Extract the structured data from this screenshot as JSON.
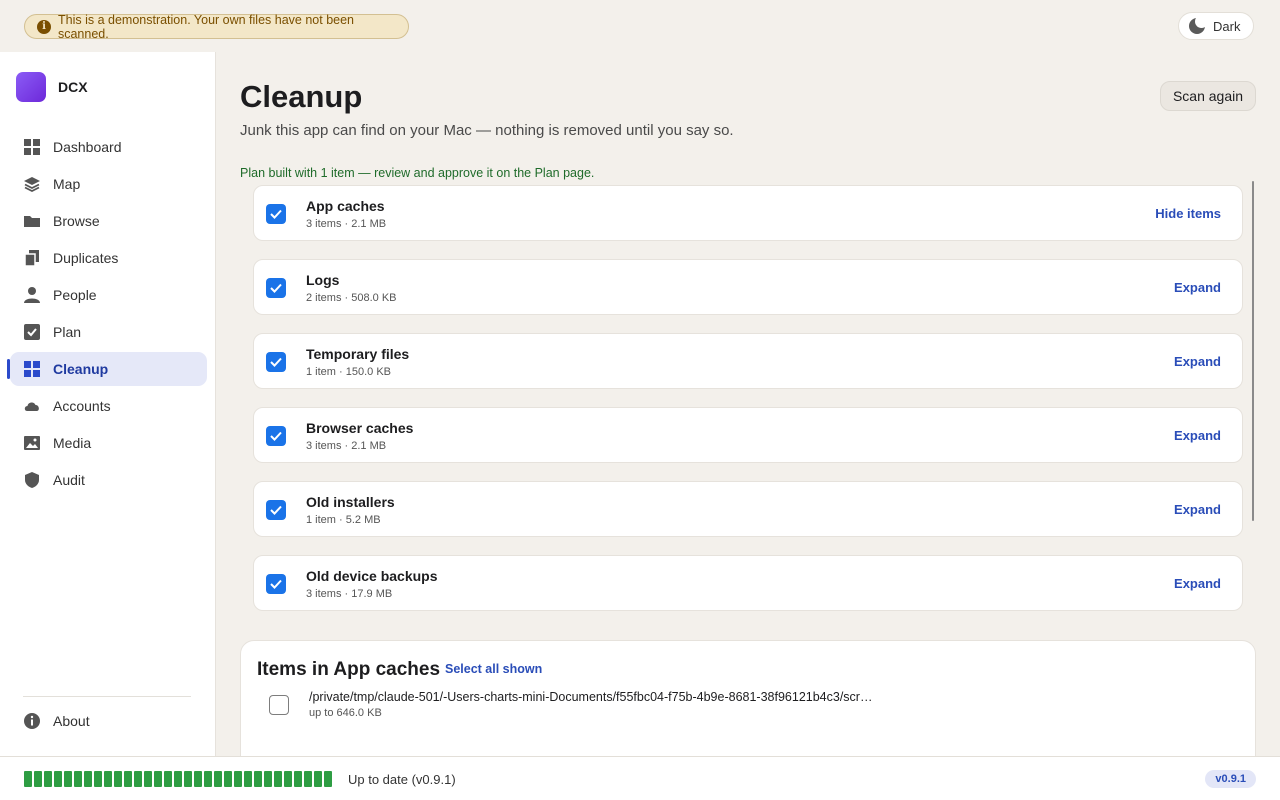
{
  "banner": {
    "text": "This is a demonstration. Your own files have not been scanned.",
    "icon": "info-icon"
  },
  "theme_toggle": {
    "label": "Dark",
    "icon": "moon-icon"
  },
  "brand": {
    "name": "DCX"
  },
  "sidebar": {
    "items": [
      {
        "label": "Dashboard",
        "icon": "grid-icon"
      },
      {
        "label": "Map",
        "icon": "layers-icon"
      },
      {
        "label": "Browse",
        "icon": "folder-icon"
      },
      {
        "label": "Duplicates",
        "icon": "copy-icon"
      },
      {
        "label": "People",
        "icon": "person-icon"
      },
      {
        "label": "Plan",
        "icon": "checkbox-icon"
      },
      {
        "label": "Cleanup",
        "icon": "grid-icon",
        "active": true
      },
      {
        "label": "Accounts",
        "icon": "cloud-icon"
      },
      {
        "label": "Media",
        "icon": "image-icon"
      },
      {
        "label": "Audit",
        "icon": "shield-icon"
      }
    ],
    "about": "About"
  },
  "main": {
    "title": "Cleanup",
    "subtitle": "Junk this app can find on your Mac — nothing is removed until you say so.",
    "scan_again": "Scan again",
    "plan_message": "Plan built with 1 item — review and approve it on the Plan page.",
    "categories": [
      {
        "name": "App caches",
        "meta": "3 items · 2.1 MB",
        "action": "Hide items",
        "checked": true
      },
      {
        "name": "Logs",
        "meta": "2 items · 508.0 KB",
        "action": "Expand",
        "checked": true
      },
      {
        "name": "Temporary files",
        "meta": "1 item · 150.0 KB",
        "action": "Expand",
        "checked": true
      },
      {
        "name": "Browser caches",
        "meta": "3 items · 2.1 MB",
        "action": "Expand",
        "checked": true
      },
      {
        "name": "Old installers",
        "meta": "1 item · 5.2 MB",
        "action": "Expand",
        "checked": true
      },
      {
        "name": "Old device backups",
        "meta": "3 items · 17.9 MB",
        "action": "Expand",
        "checked": true
      }
    ],
    "items_panel": {
      "title": "Items in App caches",
      "select_all": "Select all shown",
      "rows": [
        {
          "path": "/private/tmp/claude-501/-Users-charts-mini-Documents/f55fbc04-f75b-4b9e-8681-38f96121b4c3/scr…",
          "size": "up to 646.0 KB",
          "checked": false
        }
      ]
    }
  },
  "footer": {
    "status": "Up to date (v0.9.1)",
    "version": "v0.9.1",
    "progress": 1.0,
    "accent": "#2e9d43"
  },
  "colors": {
    "accent": "#1a73e8",
    "link": "#2a4db8",
    "success_text": "#1f6b2a",
    "banner_bg": "#f3e7c8"
  }
}
